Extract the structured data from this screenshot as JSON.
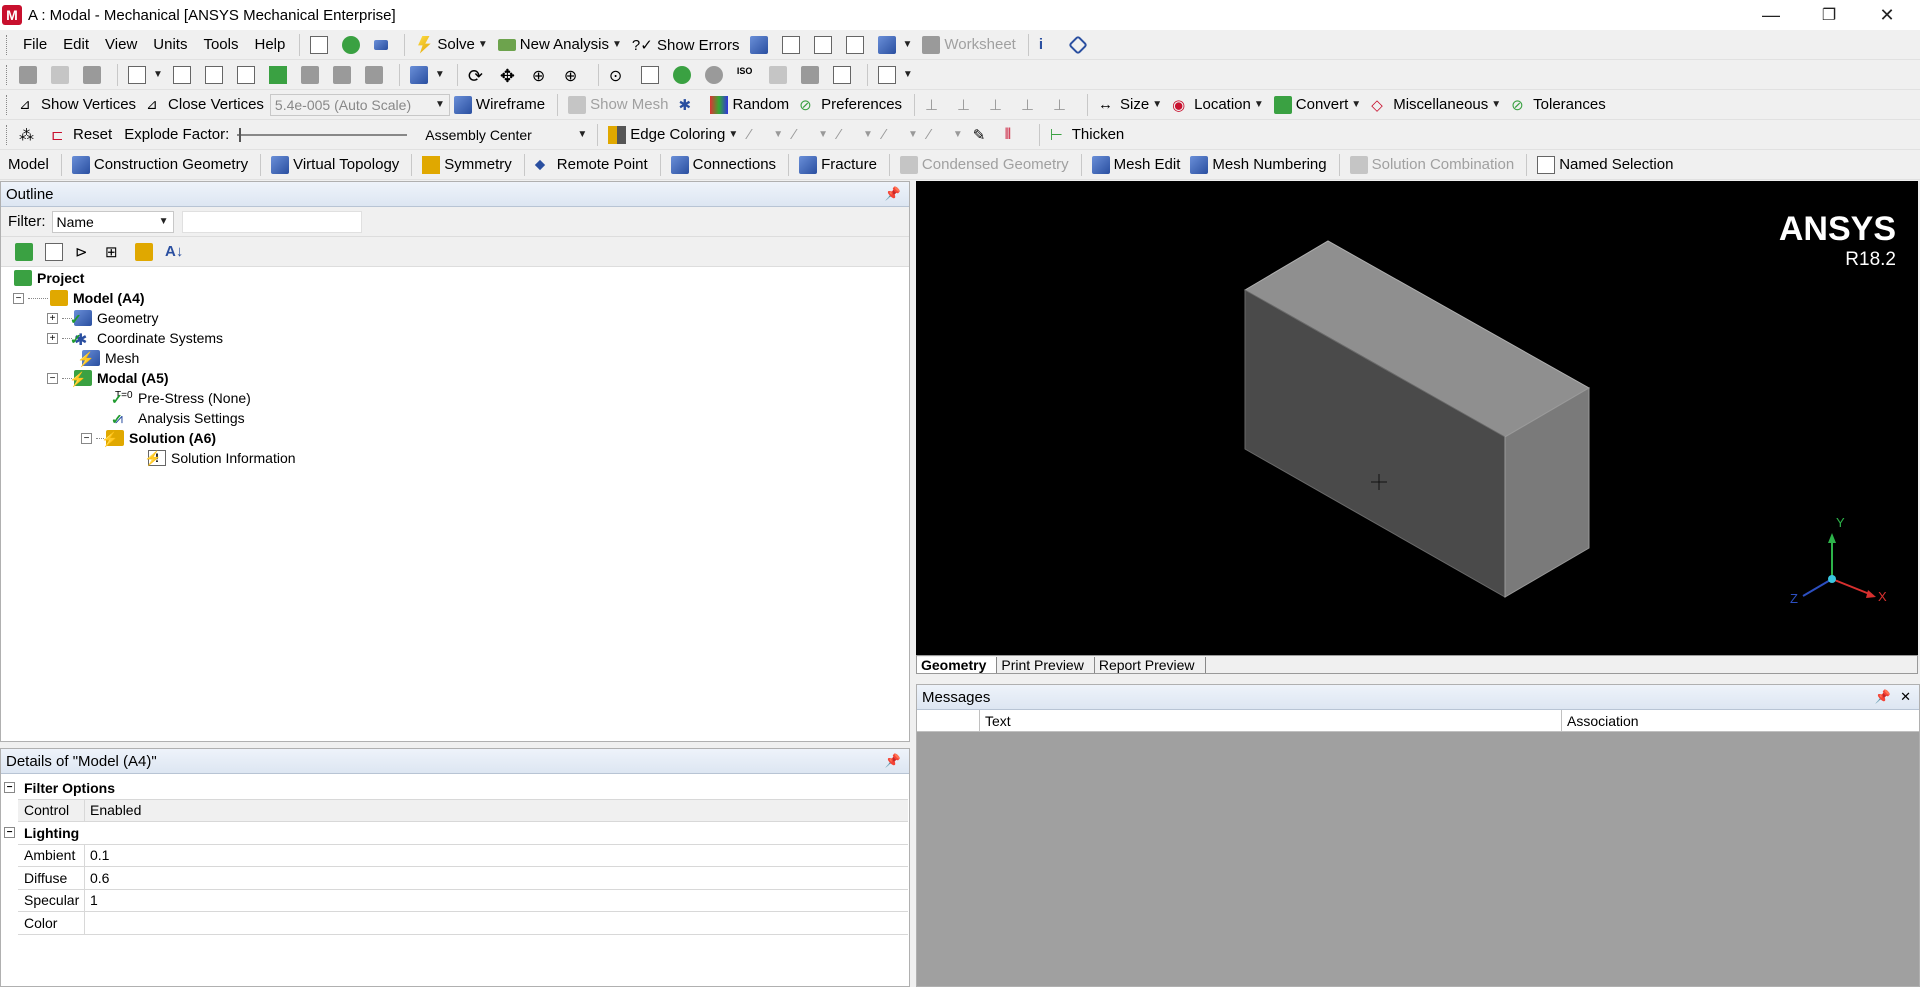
{
  "app": {
    "icon_letter": "M",
    "title": "A : Modal - Mechanical [ANSYS Mechanical Enterprise]"
  },
  "window_controls": {
    "minimize": "—",
    "restore": "❐",
    "close": "✕"
  },
  "menu": [
    "File",
    "Edit",
    "View",
    "Units",
    "Tools",
    "Help"
  ],
  "toolbar1": {
    "solve": "Solve",
    "new_analysis": "New Analysis",
    "show_errors": "?✓ Show Errors",
    "worksheet": "Worksheet"
  },
  "toolbar3": {
    "show_vertices": "Show Vertices",
    "close_vertices": "Close Vertices",
    "scale_value": "5.4e-005 (Auto Scale)",
    "wireframe": "Wireframe",
    "show_mesh": "Show Mesh",
    "random": "Random",
    "preferences": "Preferences",
    "size": "Size",
    "location": "Location",
    "convert": "Convert",
    "miscellaneous": "Miscellaneous",
    "tolerances": "Tolerances"
  },
  "toolbar4": {
    "reset": "Reset",
    "explode_factor": "Explode Factor:",
    "assembly_center": "Assembly Center",
    "edge_coloring": "Edge Coloring",
    "thicken": "Thicken"
  },
  "context_toolbar": [
    "Model",
    "Construction Geometry",
    "Virtual Topology",
    "Symmetry",
    "Remote Point",
    "Connections",
    "Fracture",
    "Condensed Geometry",
    "Mesh Edit",
    "Mesh Numbering",
    "Solution Combination",
    "Named Selection"
  ],
  "outline": {
    "header": "Outline",
    "filter_label": "Filter:",
    "filter_value": "Name",
    "tree": {
      "project": "Project",
      "model": "Model (A4)",
      "geometry": "Geometry",
      "coordinate_systems": "Coordinate Systems",
      "mesh": "Mesh",
      "modal": "Modal (A5)",
      "prestress": "Pre-Stress (None)",
      "analysis_settings": "Analysis Settings",
      "solution": "Solution (A6)",
      "solution_information": "Solution Information"
    }
  },
  "details": {
    "header": "Details of \"Model (A4)\"",
    "groups": [
      {
        "title": "Filter Options",
        "rows": [
          {
            "key": "Control",
            "value": "Enabled"
          }
        ]
      },
      {
        "title": "Lighting",
        "rows": [
          {
            "key": "Ambient",
            "value": "0.1"
          },
          {
            "key": "Diffuse",
            "value": "0.6"
          },
          {
            "key": "Specular",
            "value": "1"
          },
          {
            "key": "Color",
            "value": ""
          }
        ]
      }
    ]
  },
  "viewport": {
    "brand": "ANSYS",
    "version": "R18.2",
    "axis_x": "X",
    "axis_y": "Y",
    "axis_z": "Z"
  },
  "view_tabs": [
    "Geometry",
    "Print Preview",
    "Report Preview"
  ],
  "messages": {
    "header": "Messages",
    "col_text": "Text",
    "col_association": "Association"
  },
  "colors": {
    "viewport_bg": "#000000",
    "accent_blue": "#2a4fa0",
    "ok_green": "#1f9a2e",
    "warn_yellow": "#e0a800"
  }
}
